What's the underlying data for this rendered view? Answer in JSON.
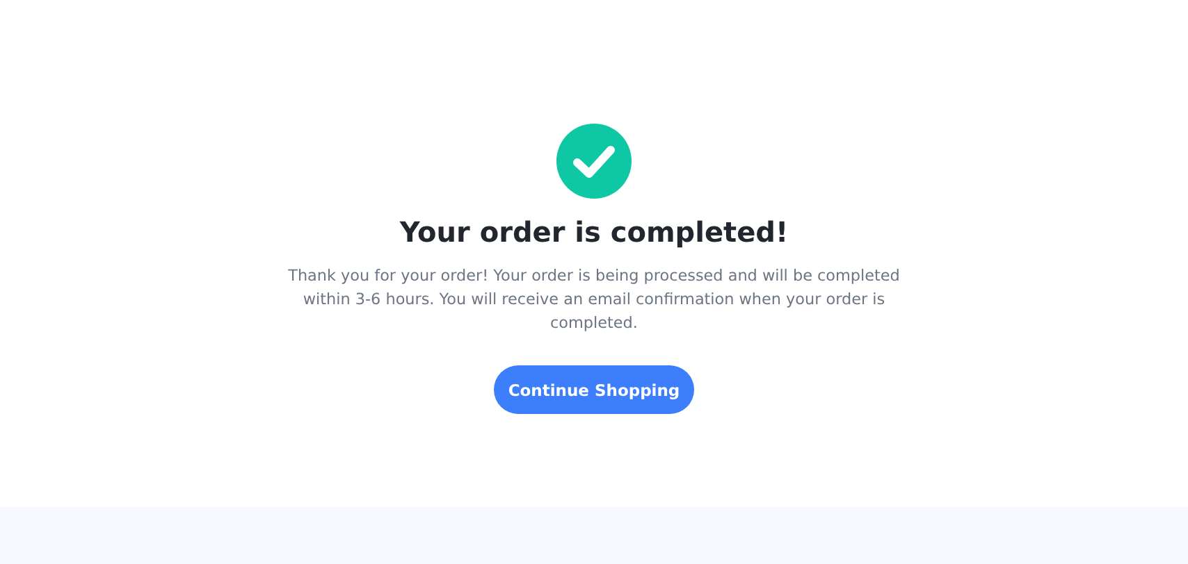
{
  "title": "Your order is completed!",
  "message": "Thank you for your order! Your order is being processed and will be completed within 3-6 hours. You will receive an email confirmation when your order is completed.",
  "button": "Continue Shopping"
}
